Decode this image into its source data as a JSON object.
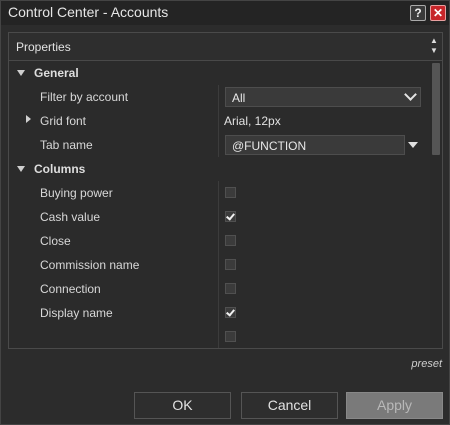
{
  "window": {
    "title": "Control Center - Accounts",
    "help_glyph": "?",
    "close_glyph": "✕"
  },
  "panel": {
    "header": "Properties"
  },
  "general": {
    "label": "General",
    "filter_label": "Filter by account",
    "filter_value": "All",
    "grid_font_label": "Grid font",
    "grid_font_value": "Arial, 12px",
    "tab_name_label": "Tab name",
    "tab_name_value": "@FUNCTION"
  },
  "columns": {
    "label": "Columns",
    "items": [
      {
        "label": "Buying power",
        "checked": false
      },
      {
        "label": "Cash value",
        "checked": true
      },
      {
        "label": "Close",
        "checked": false
      },
      {
        "label": "Commission name",
        "checked": false
      },
      {
        "label": "Connection",
        "checked": false
      },
      {
        "label": "Display name",
        "checked": true
      }
    ]
  },
  "footer": {
    "preset": "preset",
    "ok": "OK",
    "cancel": "Cancel",
    "apply": "Apply"
  },
  "colors": {
    "background": "#2c2c2c",
    "close": "#c7262a",
    "apply_disabled": "#7a7a7a"
  }
}
